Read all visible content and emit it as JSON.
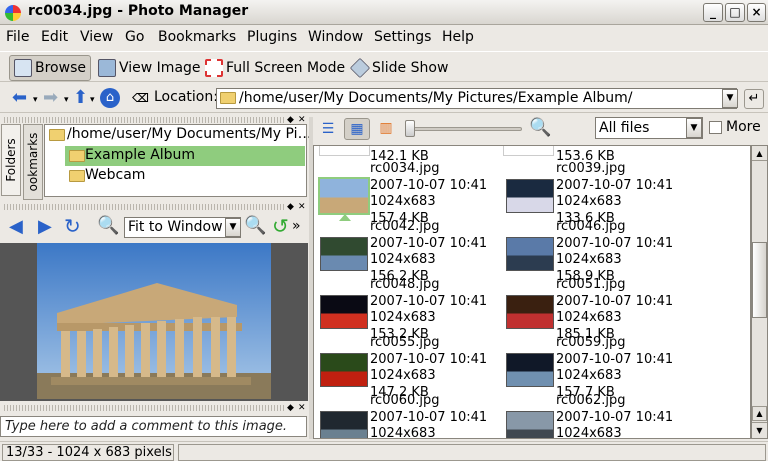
{
  "window": {
    "title": "rc0034.jpg - Photo Manager"
  },
  "menu": [
    "File",
    "Edit",
    "View",
    "Go",
    "Bookmarks",
    "Plugins",
    "Window",
    "Settings",
    "Help"
  ],
  "toolbar": {
    "browse": "Browse",
    "view_image": "View Image",
    "full_screen": "Full Screen Mode",
    "slide_show": "Slide Show"
  },
  "location": {
    "label": "Location:",
    "path": "/home/user/My Documents/My Pictures/Example Album/"
  },
  "left": {
    "tabs": {
      "folders": "Folders",
      "bookmarks": "ookmarks"
    },
    "tree": {
      "root": "/home/user/My Documents/My Pi…",
      "items": [
        "Example Album",
        "Webcam"
      ]
    },
    "viewer": {
      "zoom_mode": "Fit to Window"
    },
    "comment_placeholder": "Type here to add a comment to this image."
  },
  "right": {
    "filter": "All files",
    "more_label": "More",
    "partial_top": [
      "142.1 KB",
      "153.6 KB"
    ],
    "thumbnails": [
      {
        "name": "rc0034.jpg",
        "date": "2007-10-07 10:41",
        "dims": "1024x683",
        "size": "157.4 KB"
      },
      {
        "name": "rc0039.jpg",
        "date": "2007-10-07 10:41",
        "dims": "1024x683",
        "size": "133.6 KB"
      },
      {
        "name": "rc0042.jpg",
        "date": "2007-10-07 10:41",
        "dims": "1024x683",
        "size": "156.2 KB"
      },
      {
        "name": "rc0046.jpg",
        "date": "2007-10-07 10:41",
        "dims": "1024x683",
        "size": "158.9 KB"
      },
      {
        "name": "rc0048.jpg",
        "date": "2007-10-07 10:41",
        "dims": "1024x683",
        "size": "153.2 KB"
      },
      {
        "name": "rc0051.jpg",
        "date": "2007-10-07 10:41",
        "dims": "1024x683",
        "size": "185.1 KB"
      },
      {
        "name": "rc0055.jpg",
        "date": "2007-10-07 10:41",
        "dims": "1024x683",
        "size": "147.2 KB"
      },
      {
        "name": "rc0059.jpg",
        "date": "2007-10-07 10:41",
        "dims": "1024x683",
        "size": "157.7 KB"
      },
      {
        "name": "rc0060.jpg",
        "date": "2007-10-07 10:41",
        "dims": "1024x683",
        "size": ""
      },
      {
        "name": "rc0062.jpg",
        "date": "2007-10-07 10:41",
        "dims": "1024x683",
        "size": ""
      }
    ]
  },
  "status": {
    "text": "13/33 - 1024 x 683 pixels"
  },
  "colors": {
    "selection": "#8fcc7e",
    "accent": "#2a62c9"
  }
}
